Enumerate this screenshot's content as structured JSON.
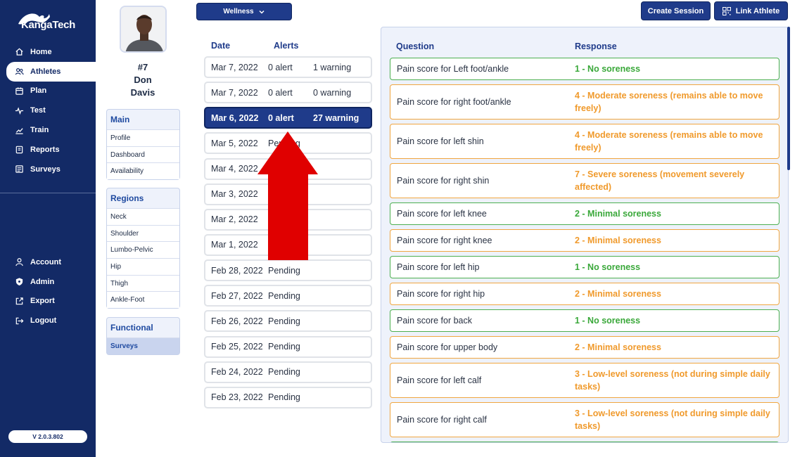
{
  "brand": {
    "name": "KangaTech",
    "version": "V 2.0.3.802"
  },
  "nav": {
    "main": [
      {
        "label": "Home",
        "icon": "home-icon"
      },
      {
        "label": "Athletes",
        "icon": "athletes-icon",
        "active": true
      },
      {
        "label": "Plan",
        "icon": "calendar-icon"
      },
      {
        "label": "Test",
        "icon": "pulse-icon"
      },
      {
        "label": "Train",
        "icon": "trend-icon"
      },
      {
        "label": "Reports",
        "icon": "clipboard-icon"
      },
      {
        "label": "Surveys",
        "icon": "survey-icon"
      }
    ],
    "bottom": [
      {
        "label": "Account",
        "icon": "user-icon"
      },
      {
        "label": "Admin",
        "icon": "shield-icon"
      },
      {
        "label": "Export",
        "icon": "export-icon"
      },
      {
        "label": "Logout",
        "icon": "logout-icon"
      }
    ]
  },
  "athlete": {
    "number": "#7",
    "first_name": "Don",
    "last_name": "Davis"
  },
  "menus": {
    "main": {
      "title": "Main",
      "items": [
        "Profile",
        "Dashboard",
        "Availability"
      ]
    },
    "regions": {
      "title": "Regions",
      "items": [
        "Neck",
        "Shoulder",
        "Lumbo-Pelvic",
        "Hip",
        "Thigh",
        "Ankle-Foot"
      ]
    },
    "functional": {
      "title": "Functional",
      "items": [
        "Surveys"
      ]
    }
  },
  "toolbar": {
    "wellness_label": "Wellness",
    "create_session_label": "Create Session",
    "link_athlete_label": "Link Athlete"
  },
  "dates_table": {
    "headers": {
      "date": "Date",
      "alerts": "Alerts"
    },
    "rows": [
      {
        "date": "Mar 7, 2022",
        "alert": "0 alert",
        "warning": "1 warning"
      },
      {
        "date": "Mar 7, 2022",
        "alert": "0 alert",
        "warning": "0 warning"
      },
      {
        "date": "Mar 6, 2022",
        "alert": "0 alert",
        "warning": "27 warning",
        "selected": true
      },
      {
        "date": "Mar 5, 2022",
        "alert": "Pending",
        "warning": ""
      },
      {
        "date": "Mar 4, 2022",
        "alert": "",
        "warning": ""
      },
      {
        "date": "Mar 3, 2022",
        "alert": "",
        "warning": ""
      },
      {
        "date": "Mar 2, 2022",
        "alert": "",
        "warning": ""
      },
      {
        "date": "Mar 1, 2022",
        "alert": "",
        "warning": ""
      },
      {
        "date": "Feb 28, 2022",
        "alert": "Pending",
        "warning": ""
      },
      {
        "date": "Feb 27, 2022",
        "alert": "Pending",
        "warning": ""
      },
      {
        "date": "Feb 26, 2022",
        "alert": "Pending",
        "warning": ""
      },
      {
        "date": "Feb 25, 2022",
        "alert": "Pending",
        "warning": ""
      },
      {
        "date": "Feb 24, 2022",
        "alert": "Pending",
        "warning": ""
      },
      {
        "date": "Feb 23, 2022",
        "alert": "Pending",
        "warning": ""
      }
    ]
  },
  "survey": {
    "headers": {
      "question": "Question",
      "response": "Response"
    },
    "items": [
      {
        "question": "Pain score for Left foot/ankle",
        "response": "1 - No soreness",
        "status": "green"
      },
      {
        "question": "Pain score for right foot/ankle",
        "response": "4 - Moderate soreness (remains able to move freely)",
        "status": "orange"
      },
      {
        "question": "Pain score for left shin",
        "response": "4 - Moderate soreness (remains able to move freely)",
        "status": "orange"
      },
      {
        "question": "Pain score for right shin",
        "response": "7 - Severe soreness (movement severely affected)",
        "status": "orange"
      },
      {
        "question": "Pain score for left knee",
        "response": "2 - Minimal soreness",
        "status": "green"
      },
      {
        "question": "Pain score for right knee",
        "response": "2 - Minimal soreness",
        "status": "orange"
      },
      {
        "question": "Pain score for left hip",
        "response": "1 - No soreness",
        "status": "green"
      },
      {
        "question": "Pain score for right hip",
        "response": "2 - Minimal soreness",
        "status": "orange"
      },
      {
        "question": "Pain score for back",
        "response": "1 - No soreness",
        "status": "green"
      },
      {
        "question": "Pain score for upper body",
        "response": "2 - Minimal soreness",
        "status": "orange"
      },
      {
        "question": "Pain score for left calf",
        "response": "3 - Low-level soreness (not during simple daily tasks)",
        "status": "orange"
      },
      {
        "question": "Pain score for right calf",
        "response": "3 - Low-level soreness (not during simple daily tasks)",
        "status": "orange"
      },
      {
        "question": "",
        "response": "",
        "status": "green"
      }
    ]
  },
  "colors": {
    "navy": "#132a66",
    "accent": "#1f3b8a",
    "green": "#3aa83a",
    "orange": "#f09a2c",
    "arrow": "#e00000"
  }
}
